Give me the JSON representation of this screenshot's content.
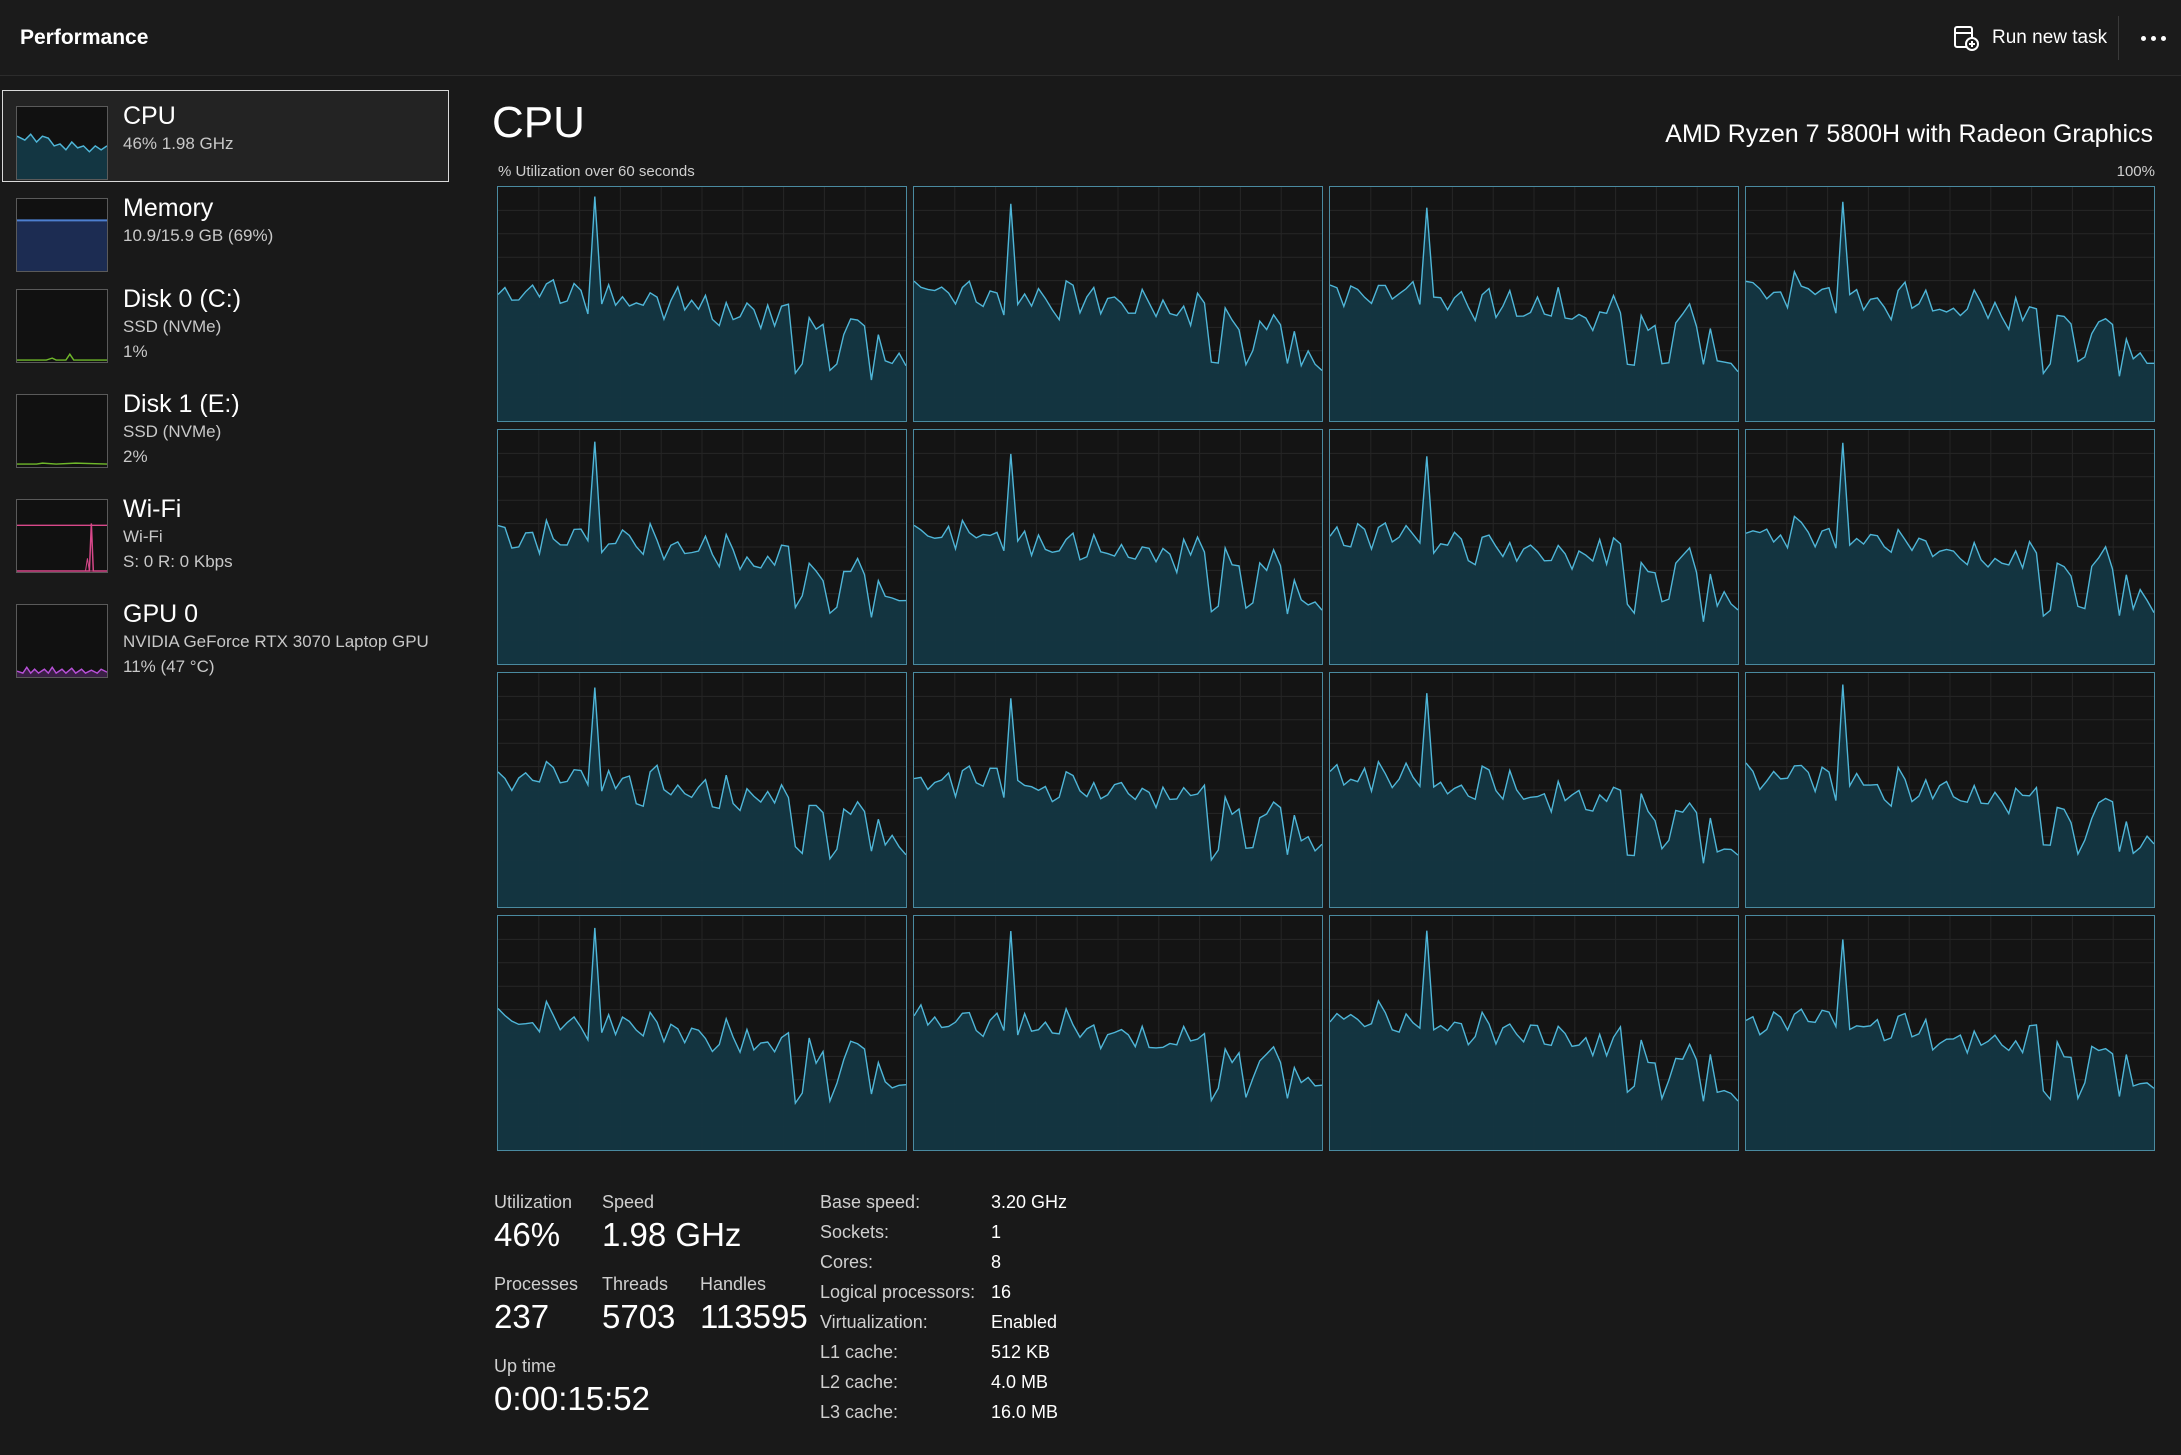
{
  "header": {
    "title": "Performance",
    "run_new_task": "Run new task"
  },
  "sidebar": {
    "items": [
      {
        "name": "CPU",
        "line1": "46%  1.98 GHz",
        "line2": ""
      },
      {
        "name": "Memory",
        "line1": "10.9/15.9 GB (69%)",
        "line2": ""
      },
      {
        "name": "Disk 0 (C:)",
        "line1": "SSD (NVMe)",
        "line2": "1%"
      },
      {
        "name": "Disk 1 (E:)",
        "line1": "SSD (NVMe)",
        "line2": "2%"
      },
      {
        "name": "Wi-Fi",
        "line1": "Wi-Fi",
        "line2": "S: 0  R: 0 Kbps"
      },
      {
        "name": "GPU 0",
        "line1": "NVIDIA GeForce RTX 3070 Laptop GPU",
        "line2": "11%  (47 °C)"
      }
    ]
  },
  "main": {
    "title": "CPU",
    "model": "AMD Ryzen 7 5800H with Radeon Graphics",
    "graph_label": "% Utilization over 60 seconds",
    "graph_max": "100%",
    "logical_processor_graphs": 16,
    "graph_line_color": "#4fb6d8",
    "graph_fill_color": "#133642"
  },
  "stats": {
    "utilization_label": "Utilization",
    "utilization": "46%",
    "speed_label": "Speed",
    "speed": "1.98 GHz",
    "processes_label": "Processes",
    "processes": "237",
    "threads_label": "Threads",
    "threads": "5703",
    "handles_label": "Handles",
    "handles": "113595",
    "uptime_label": "Up time",
    "uptime": "0:00:15:52"
  },
  "specs": [
    {
      "label": "Base speed:",
      "value": "3.20 GHz"
    },
    {
      "label": "Sockets:",
      "value": "1"
    },
    {
      "label": "Cores:",
      "value": "8"
    },
    {
      "label": "Logical processors:",
      "value": "16"
    },
    {
      "label": "Virtualization:",
      "value": "Enabled"
    },
    {
      "label": "L1 cache:",
      "value": "512 KB"
    },
    {
      "label": "L2 cache:",
      "value": "4.0 MB"
    },
    {
      "label": "L3 cache:",
      "value": "16.0 MB"
    }
  ],
  "colors": {
    "background": "#191919",
    "cpu_accent": "#4fb6d8",
    "memory_accent": "#4d7fd0",
    "disk_accent": "#6fb82a",
    "wifi_accent": "#d8488a",
    "gpu_accent": "#b850d8"
  }
}
